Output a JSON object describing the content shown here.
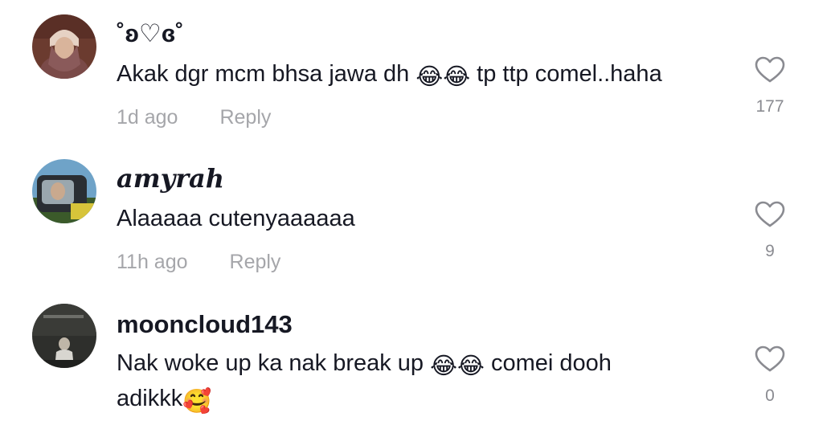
{
  "comments": [
    {
      "username": "˚ʚ♡ɞ˚",
      "text_before": "Akak dgr mcm bhsa jawa dh ",
      "emoji_1": "😂😂",
      "text_after": " tp ttp comel..haha",
      "time": "1d ago",
      "reply_label": "Reply",
      "likes": "177"
    },
    {
      "username": "amyrah",
      "text": "Alaaaaa cutenyaaaaaa",
      "time": "11h ago",
      "reply_label": "Reply",
      "likes": "9"
    },
    {
      "username": "mooncloud143",
      "text_before": "Nak woke up ka nak break up ",
      "emoji_1": "😂😂",
      "text_middle": " comei dooh",
      "text_line2": "adikkk",
      "emoji_2": "🥰",
      "likes": "0"
    }
  ],
  "icons": {
    "like": "heart-outline-icon"
  },
  "colors": {
    "text": "#161823",
    "muted": "#a5a6aa",
    "count": "#8a8b91",
    "emoji_yellow": "#f7c531"
  }
}
